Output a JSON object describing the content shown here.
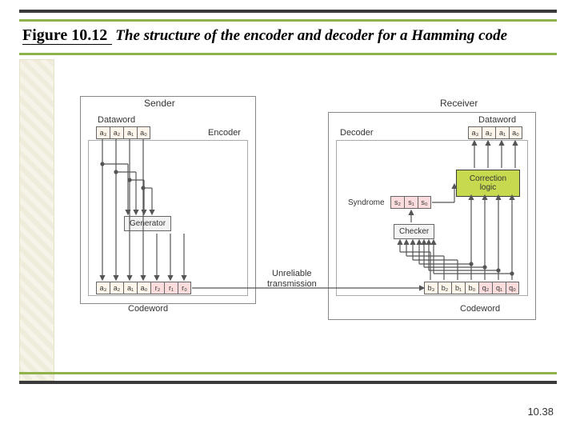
{
  "title": {
    "figure": "Figure 10.12",
    "caption": "The structure of the encoder and decoder for a Hamming code"
  },
  "page": "10.38",
  "sender": {
    "label": "Sender",
    "dataword_label": "Dataword",
    "encoder_label": "Encoder",
    "generator_label": "Generator",
    "codeword_label": "Codeword",
    "dataword": [
      "a₃",
      "a₂",
      "a₁",
      "a₀"
    ],
    "codeword_data": [
      "a₃",
      "a₂",
      "a₁",
      "a₀"
    ],
    "codeword_parity": [
      "r₂",
      "r₁",
      "r₀"
    ]
  },
  "receiver": {
    "label": "Receiver",
    "dataword_label": "Dataword",
    "decoder_label": "Decoder",
    "checker_label": "Checker",
    "correction_label": "Correction logic",
    "syndrome_label": "Syndrome",
    "codeword_label": "Codeword",
    "dataword": [
      "a₃",
      "a₂",
      "a₁",
      "a₀"
    ],
    "syndrome": [
      "s₂",
      "s₁",
      "s₀"
    ],
    "codeword_data": [
      "b₃",
      "b₂",
      "b₁",
      "b₀"
    ],
    "codeword_parity": [
      "q₂",
      "q₁",
      "q₀"
    ]
  },
  "channel": "Unreliable transmission"
}
